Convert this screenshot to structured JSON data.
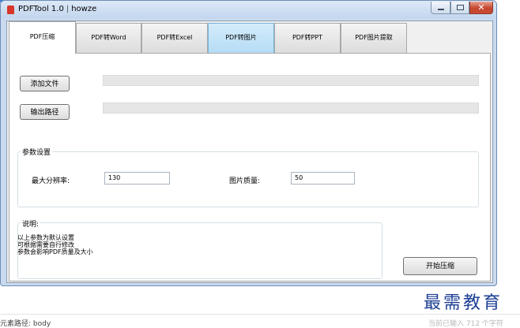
{
  "window": {
    "app_name": "PDFTool 1.0",
    "separator": "|",
    "user": "howze",
    "close_glyph": "✕"
  },
  "tabs": [
    {
      "label": "PDF压缩"
    },
    {
      "label": "PDF转Word"
    },
    {
      "label": "PDF转Excel"
    },
    {
      "label": "PDF转图片"
    },
    {
      "label": "PDF转PPT"
    },
    {
      "label": "PDF图片提取"
    }
  ],
  "files": {
    "add_file_button": "添加文件",
    "add_file_path": "",
    "output_path_button": "输出路径",
    "output_path": ""
  },
  "settings": {
    "legend": "参数设置",
    "max_resolution_label": "最大分辨率:",
    "max_resolution_value": "130",
    "image_quality_label": "图片质量:",
    "image_quality_value": "50"
  },
  "notes": {
    "legend": "说明:",
    "lines": [
      "以上参数为默认设置",
      "可根据需要自行修改",
      "参数会影响PDF质量及大小"
    ]
  },
  "start_button": "开始压缩",
  "watermark": "最需教育",
  "footer": {
    "left": "元素路径: body",
    "right": "当前已输入 712 个字符"
  },
  "colors": {
    "accent": "#3c7fd6",
    "hot_tab": "#b6dcf4",
    "watermark": "#1d3f94"
  }
}
